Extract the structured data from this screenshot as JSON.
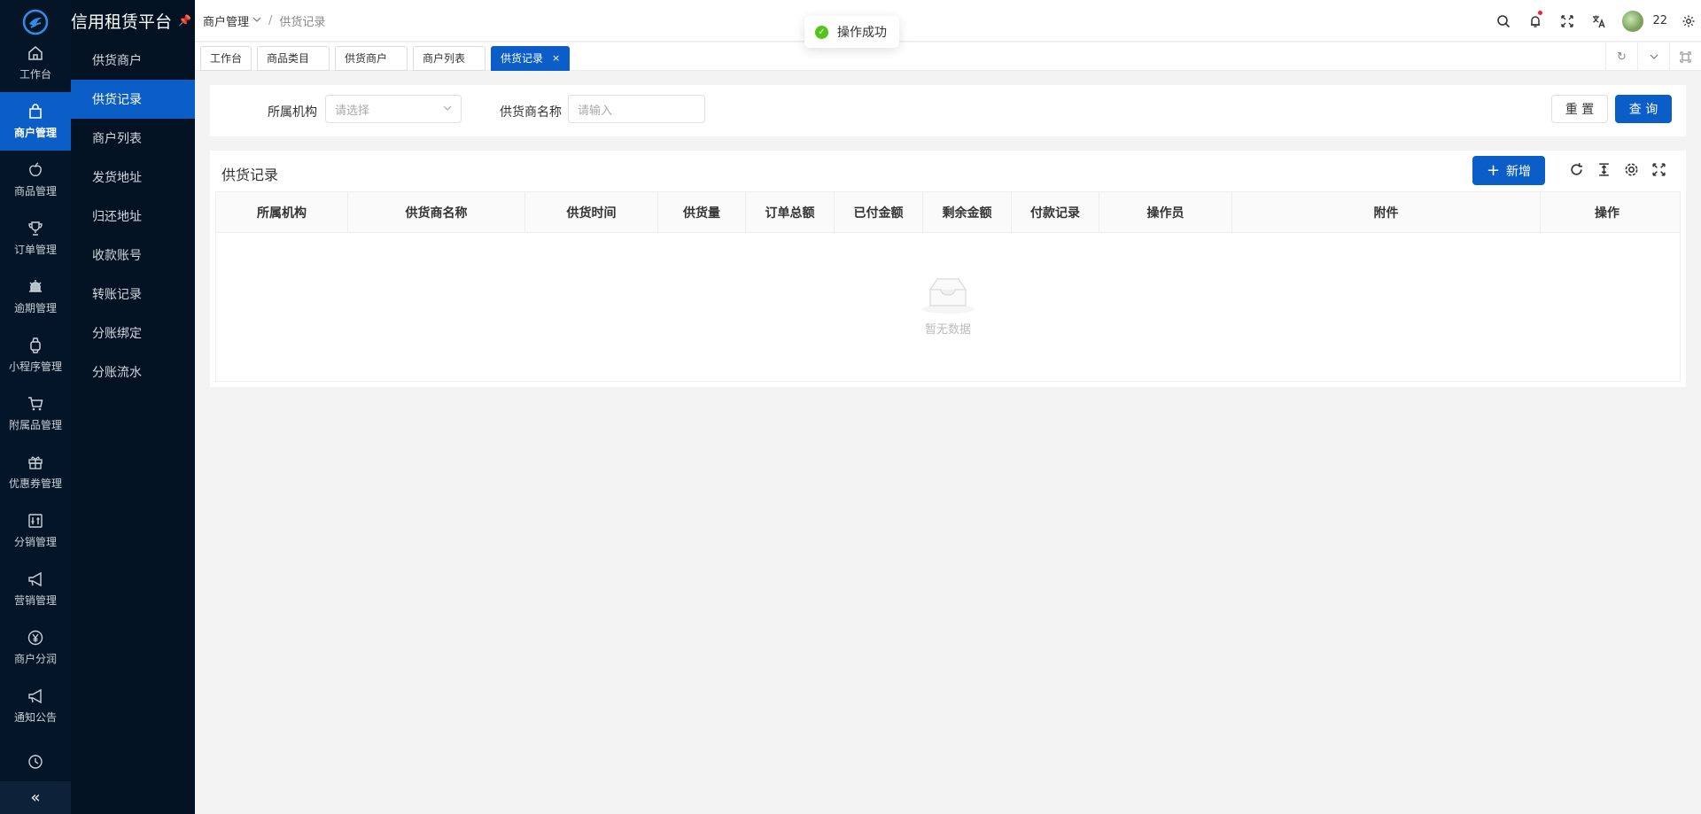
{
  "brand": {
    "name": "信用租赁平台"
  },
  "rail": [
    {
      "label": "工作台",
      "icon": "home-icon"
    },
    {
      "label": "商户管理",
      "icon": "bag-icon",
      "active": true
    },
    {
      "label": "商品管理",
      "icon": "apple-icon"
    },
    {
      "label": "订单管理",
      "icon": "trophy-icon"
    },
    {
      "label": "逾期管理",
      "icon": "alarm-icon"
    },
    {
      "label": "小程序管理",
      "icon": "watch-icon"
    },
    {
      "label": "附属品管理",
      "icon": "cart-icon"
    },
    {
      "label": "优惠券管理",
      "icon": "gift-icon"
    },
    {
      "label": "分销管理",
      "icon": "sliders-icon"
    },
    {
      "label": "营销管理",
      "icon": "megaphone-icon"
    },
    {
      "label": "商户分润",
      "icon": "yen-icon"
    },
    {
      "label": "通知公告",
      "icon": "announce-icon"
    },
    {
      "label": "",
      "icon": "clock-icon"
    }
  ],
  "submenu": [
    {
      "label": "供货商户"
    },
    {
      "label": "供货记录",
      "active": true
    },
    {
      "label": "商户列表"
    },
    {
      "label": "发货地址"
    },
    {
      "label": "归还地址"
    },
    {
      "label": "收款账号"
    },
    {
      "label": "转账记录"
    },
    {
      "label": "分账绑定"
    },
    {
      "label": "分账流水"
    }
  ],
  "breadcrumb": {
    "parent": "商户管理",
    "current": "供货记录"
  },
  "user": {
    "name": "22"
  },
  "toast": {
    "message": "操作成功"
  },
  "tabs": [
    {
      "label": "工作台"
    },
    {
      "label": "商品类目"
    },
    {
      "label": "供货商户"
    },
    {
      "label": "商户列表"
    },
    {
      "label": "供货记录",
      "active": true
    }
  ],
  "search": {
    "org_label": "所属机构",
    "org_placeholder": "请选择",
    "supplier_label": "供货商名称",
    "supplier_placeholder": "请输入",
    "reset_label": "重 置",
    "query_label": "查 询"
  },
  "table": {
    "title": "供货记录",
    "add_label": "新增",
    "columns": [
      "所属机构",
      "供货商名称",
      "供货时间",
      "供货量",
      "订单总额",
      "已付金额",
      "剩余金额",
      "付款记录",
      "操作员",
      "附件",
      "操作"
    ],
    "empty_text": "暂无数据"
  },
  "colors": {
    "primary": "#0b5ec7",
    "sidebar": "#041527",
    "success": "#52c41a"
  }
}
